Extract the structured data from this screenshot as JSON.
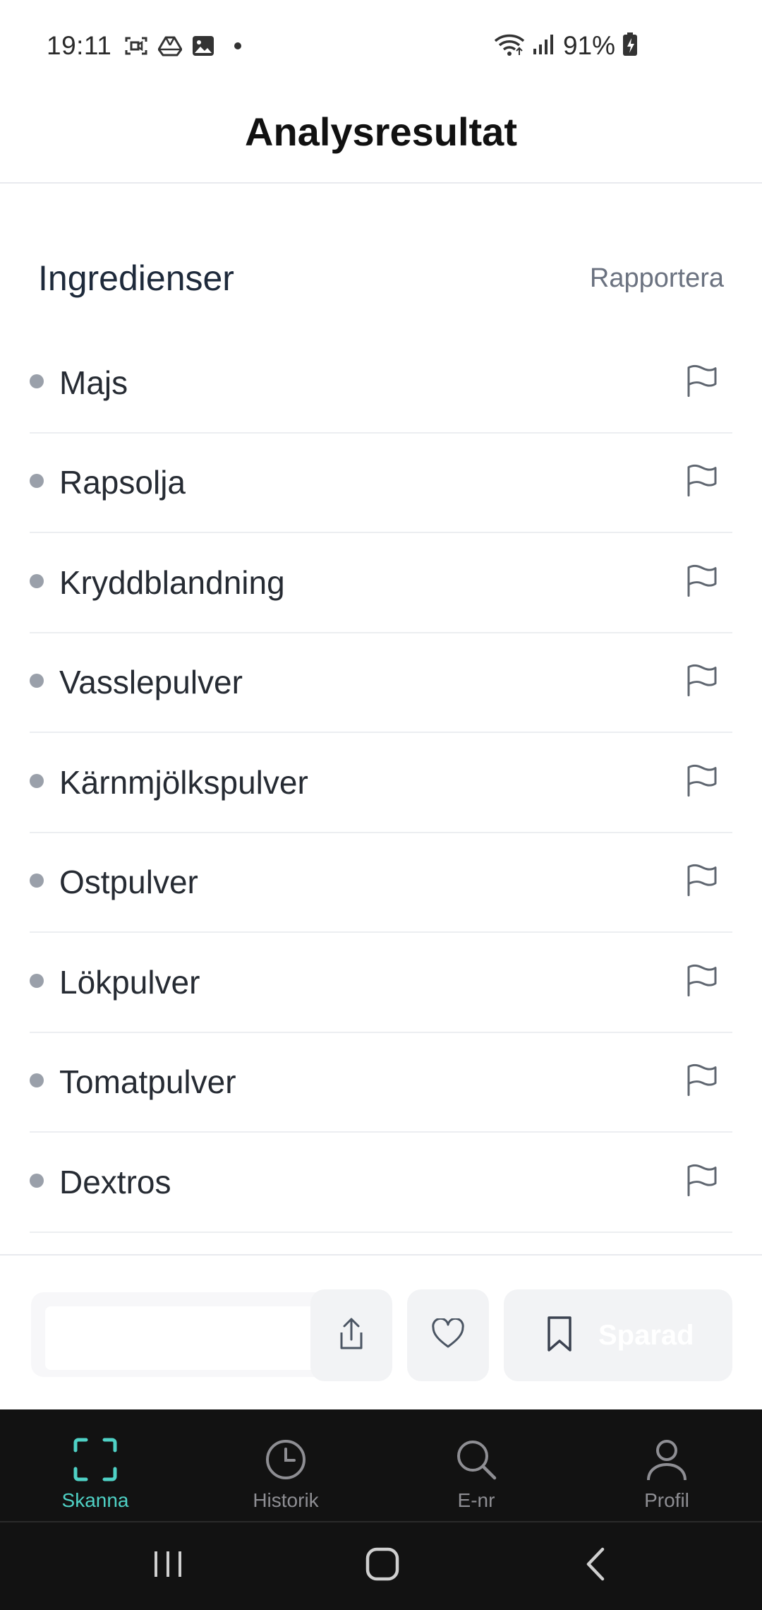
{
  "status_bar": {
    "time": "19:11",
    "battery": "91%"
  },
  "header": {
    "title": "Analysresultat"
  },
  "section": {
    "title": "Ingredienser",
    "report_label": "Rapportera"
  },
  "ingredients": [
    "Majs",
    "Rapsolja",
    "Kryddblandning",
    "Vasslepulver",
    "Kärnmjölkspulver",
    "Ostpulver",
    "Lökpulver",
    "Tomatpulver",
    "Dextros"
  ],
  "actions": {
    "saved_label": "Sparad"
  },
  "bottom_nav": {
    "items": [
      {
        "label": "Skanna",
        "icon": "scan-icon",
        "active": true
      },
      {
        "label": "Historik",
        "icon": "clock-icon",
        "active": false
      },
      {
        "label": "E-nr",
        "icon": "search-icon",
        "active": false
      },
      {
        "label": "Profil",
        "icon": "user-icon",
        "active": false
      }
    ]
  },
  "colors": {
    "accent": "#4fd1c5",
    "nav_background": "#121212",
    "muted": "#6b7280"
  }
}
